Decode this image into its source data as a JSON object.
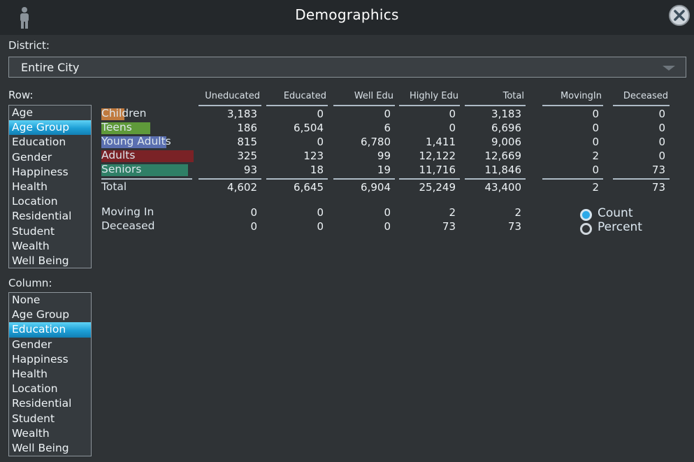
{
  "window": {
    "title": "Demographics"
  },
  "icons": {
    "person": "person-icon",
    "close": "close-icon",
    "dropdown": "chevron-down-icon"
  },
  "labels": {
    "district": "District:",
    "row": "Row:",
    "column": "Column:"
  },
  "district": {
    "value": "Entire City"
  },
  "row_options": [
    "Age",
    "Age Group",
    "Education",
    "Gender",
    "Happiness",
    "Health",
    "Location",
    "Residential",
    "Student",
    "Wealth",
    "Well Being"
  ],
  "row_selected": "Age Group",
  "column_options": [
    "None",
    "Age Group",
    "Education",
    "Gender",
    "Happiness",
    "Health",
    "Location",
    "Residential",
    "Student",
    "Wealth",
    "Well Being"
  ],
  "column_selected": "Education",
  "table": {
    "headers": [
      "Uneducated",
      "Educated",
      "Well Edu",
      "Highly Edu",
      "Total",
      "MovingIn",
      "Deceased"
    ],
    "rows": [
      {
        "label": "Children",
        "color": "#c07a3e",
        "values": [
          "3,183",
          "0",
          "0",
          "0",
          "3,183",
          "0",
          "0"
        ]
      },
      {
        "label": "Teens",
        "color": "#5f9a3a",
        "values": [
          "186",
          "6,504",
          "6",
          "0",
          "6,696",
          "0",
          "0"
        ]
      },
      {
        "label": "Young Adults",
        "color": "#5a6fb0",
        "values": [
          "815",
          "0",
          "6,780",
          "1,411",
          "9,006",
          "0",
          "0"
        ]
      },
      {
        "label": "Adults",
        "color": "#7a2226",
        "values": [
          "325",
          "123",
          "99",
          "12,122",
          "12,669",
          "2",
          "0"
        ]
      },
      {
        "label": "Seniors",
        "color": "#2f7f66",
        "values": [
          "93",
          "18",
          "19",
          "11,716",
          "11,846",
          "0",
          "73"
        ]
      }
    ],
    "total": {
      "label": "Total",
      "values": [
        "4,602",
        "6,645",
        "6,904",
        "25,249",
        "43,400",
        "2",
        "73"
      ]
    },
    "extra_rows": [
      {
        "label": "Moving In",
        "values": [
          "0",
          "0",
          "0",
          "2",
          "2"
        ]
      },
      {
        "label": "Deceased",
        "values": [
          "0",
          "0",
          "0",
          "73",
          "73"
        ]
      }
    ]
  },
  "display_mode": {
    "options": [
      {
        "label": "Count",
        "selected": true
      },
      {
        "label": "Percent",
        "selected": false
      }
    ]
  },
  "colors": {
    "accent": "#1d9fd6",
    "background": "#2f3336",
    "titlebar": "#24282b"
  }
}
